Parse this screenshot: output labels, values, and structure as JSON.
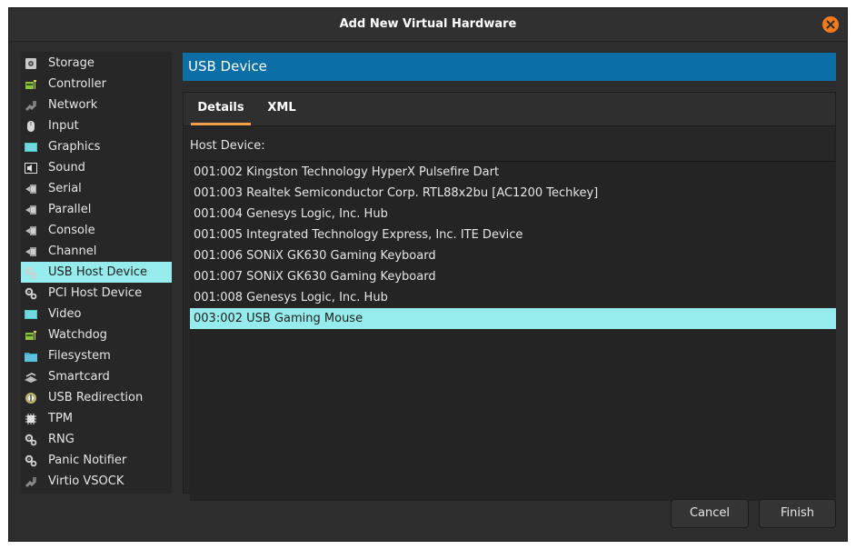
{
  "window": {
    "title": "Add New Virtual Hardware"
  },
  "sidebar": {
    "items": [
      {
        "label": "Storage",
        "icon": "disk-icon"
      },
      {
        "label": "Controller",
        "icon": "controller-icon"
      },
      {
        "label": "Network",
        "icon": "network-icon"
      },
      {
        "label": "Input",
        "icon": "mouse-icon"
      },
      {
        "label": "Graphics",
        "icon": "monitor-icon"
      },
      {
        "label": "Sound",
        "icon": "speaker-icon"
      },
      {
        "label": "Serial",
        "icon": "serial-plug-icon"
      },
      {
        "label": "Parallel",
        "icon": "parallel-plug-icon"
      },
      {
        "label": "Console",
        "icon": "console-plug-icon"
      },
      {
        "label": "Channel",
        "icon": "channel-plug-icon"
      },
      {
        "label": "USB Host Device",
        "icon": "gears-icon",
        "selected": true
      },
      {
        "label": "PCI Host Device",
        "icon": "gears-icon"
      },
      {
        "label": "Video",
        "icon": "monitor-icon"
      },
      {
        "label": "Watchdog",
        "icon": "watchdog-icon"
      },
      {
        "label": "Filesystem",
        "icon": "folder-icon"
      },
      {
        "label": "Smartcard",
        "icon": "smartcard-icon"
      },
      {
        "label": "USB Redirection",
        "icon": "usb-redirect-icon"
      },
      {
        "label": "TPM",
        "icon": "chip-icon"
      },
      {
        "label": "RNG",
        "icon": "gears-icon"
      },
      {
        "label": "Panic Notifier",
        "icon": "gears-icon"
      },
      {
        "label": "Virtio VSOCK",
        "icon": "network-icon"
      }
    ]
  },
  "main": {
    "header": "USB Device",
    "tabs": [
      {
        "label": "Details",
        "active": true
      },
      {
        "label": "XML",
        "active": false
      }
    ],
    "host_device_label": "Host Device:",
    "devices": [
      {
        "label": "001:002 Kingston Technology HyperX Pulsefire Dart"
      },
      {
        "label": "001:003 Realtek Semiconductor Corp. RTL88x2bu [AC1200 Techkey]"
      },
      {
        "label": "001:004 Genesys Logic, Inc. Hub"
      },
      {
        "label": "001:005 Integrated Technology Express, Inc. ITE Device"
      },
      {
        "label": "001:006 SONiX GK630 Gaming Keyboard"
      },
      {
        "label": "001:007 SONiX GK630 Gaming Keyboard"
      },
      {
        "label": "001:008 Genesys Logic, Inc. Hub"
      },
      {
        "label": "003:002 USB Gaming Mouse",
        "selected": true
      }
    ]
  },
  "buttons": {
    "cancel": "Cancel",
    "finish": "Finish"
  },
  "colors": {
    "accent_header": "#0b6ea6",
    "selection": "#96ecec",
    "tab_underline": "#f7a04a",
    "close_button": "#f37b1d"
  }
}
